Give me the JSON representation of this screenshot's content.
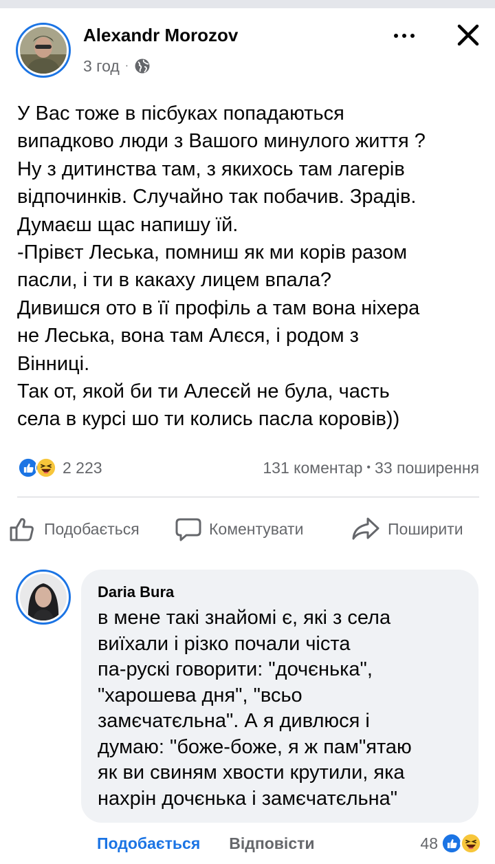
{
  "post": {
    "author": "Alexandr Morozov",
    "time": "3 год",
    "privacy_icon": "globe-icon",
    "text_lines": [
      "У Вас тоже в пісбуках попадаються",
      "випадково люди з Вашого минулого життя ?",
      "Ну з дитинства там, з якихось там лагерів",
      "відпочинків. Случайно так побачив. Зрадів.",
      "Думаєш щас напишу їй.",
      "-Прівєт Леська, помниш як ми корів разом",
      "пасли, і ти в какаху лицем впала?",
      "Дивишся ото в її профіль а там вона ніхера",
      "не Леська, вона там Алєся, і родом з",
      "Вінниці.",
      "Так от, якой би ти Алесєй не була, часть",
      "села в курсі шо ти колись пасла коровів))"
    ]
  },
  "stats": {
    "reaction_count": "2 223",
    "comments": "131 коментар",
    "separator": "•",
    "shares": "33 поширення"
  },
  "actions": {
    "like": "Подобається",
    "comment": "Коментувати",
    "share": "Поширити"
  },
  "comment": {
    "author": "Daria Bura",
    "text_lines": [
      "в мене такі знайомі є, які з села",
      "виїхали і різко почали чіста",
      "па-рускі говорити: \"дочєнька\",",
      "\"харошева дня\", \"всьо",
      "замєчатєльна\". А я дивлюся і",
      "думаю: \"боже-боже, я ж пам\"ятаю",
      "як ви свиням хвости крутили, яка",
      "нахрін дочєнька і замєчатєльна\""
    ],
    "like_label": "Подобається",
    "reply_label": "Відповісти",
    "reaction_count": "48"
  },
  "colors": {
    "accent": "#1b74e4",
    "secondary_text": "#65676b",
    "bubble": "#f0f2f5"
  }
}
